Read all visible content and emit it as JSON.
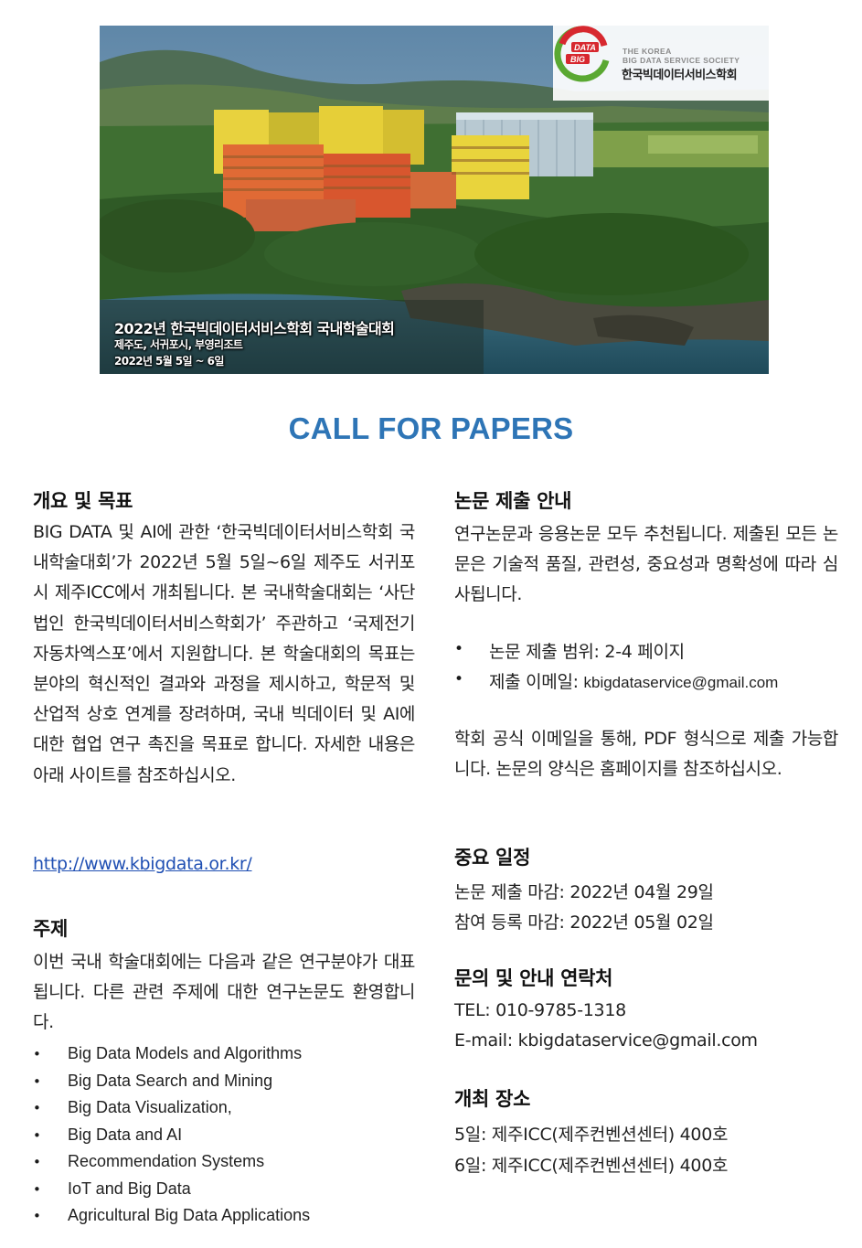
{
  "hero": {
    "logo": {
      "mark_text_top": "DATA",
      "mark_text_bottom": "BIG",
      "line1": "THE KOREA",
      "line2": "BIG DATA SERVICE SOCIETY",
      "name_kr": "한국빅데이터서비스학회"
    },
    "caption_title": "2022년 한국빅데이터서비스학회 국내학술대회",
    "caption_location": "제주도, 서귀포시, 부영리조트",
    "caption_date": "2022년 5월 5일 ~ 6일",
    "image_description": "aerial-photo-jeju-resort-coast"
  },
  "title": "CALL FOR PAPERS",
  "left": {
    "overview": {
      "heading": "개요 및 목표",
      "body": "BIG DATA 및 AI에 관한 ‘한국빅데이터서비스학회 국내학술대회’가 2022년 5월 5일~6일 제주도 서귀포시 제주ICC에서 개최됩니다. 본 국내학술대회는 ‘사단법인 한국빅데이터서비스학회가’ 주관하고 ‘국제전기자동차엑스포’에서 지원합니다. 본 학술대회의 목표는 분야의 혁신적인 결과와 과정을 제시하고, 학문적 및 산업적 상호 연계를 장려하며, 국내 빅데이터 및 AI에 대한 협업 연구 촉진을 목표로 합니다. 자세한 내용은 아래 사이트를 참조하십시오.",
      "link": "http://www.kbigdata.or.kr/"
    },
    "topics": {
      "heading": "주제",
      "body": "이번 국내 학술대회에는 다음과 같은 연구분야가 대표됩니다. 다른 관련 주제에 대한 연구논문도 환영합니다.",
      "bullet_char": "•",
      "items": [
        "Big Data Models and Algorithms",
        "Big Data Search and Mining",
        "Big Data Visualization,",
        "Big Data and AI",
        "Recommendation Systems",
        "IoT and Big Data",
        "Agricultural Big Data Applications"
      ]
    }
  },
  "right": {
    "submission": {
      "heading": "논문 제출 안내",
      "body": "연구논문과 응용논문 모두 추천됩니다. 제출된 모든 논문은 기술적 품질, 관련성, 중요성과 명확성에 따라 심사됩니다.",
      "bullet1": "논문 제출 범위: 2-4 페이지",
      "bullet2_label": "제출 이메일: ",
      "bullet2_email": "kbigdataservice@gmail.com",
      "body2": "학회 공식 이메일을 통해, PDF 형식으로 제출 가능합니다. 논문의 양식은 홈페이지를 참조하십시오."
    },
    "dates": {
      "heading": "중요 일정",
      "line1": "논문 제출 마감: 2022년 04월 29일",
      "line2": "참여 등록 마감: 2022년 05월 02일"
    },
    "contact": {
      "heading": "문의 및 안내 연락처",
      "tel": "TEL: 010-9785-1318",
      "email": "E-mail: kbigdataservice@gmail.com"
    },
    "venue": {
      "heading": "개최 장소",
      "day5": "5일:  제주ICC(제주컨벤션센터) 400호",
      "day6": "6일:  제주ICC(제주컨벤션센터) 400호"
    }
  },
  "colors": {
    "title_blue": "#2e75b6",
    "link_blue": "#1f4fb3",
    "logo_red": "#d7282f",
    "logo_green": "#5aa832"
  }
}
